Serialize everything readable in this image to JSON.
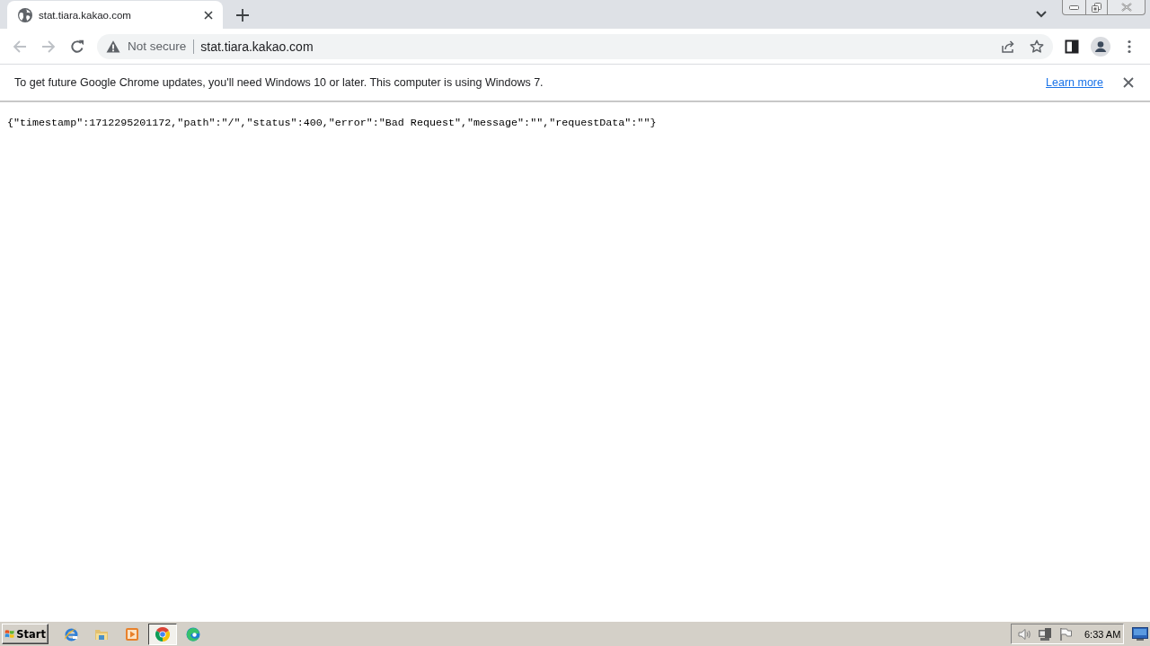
{
  "tabs": [
    {
      "title": "stat.tiara.kakao.com",
      "selected": true
    }
  ],
  "nav_buttons": [
    {
      "kind": "back",
      "disabled": true
    },
    {
      "kind": "forward",
      "disabled": true
    },
    {
      "kind": "reload",
      "disabled": false
    }
  ],
  "address_bar": {
    "security_label": "Not secure",
    "url": "stat.tiara.kakao.com"
  },
  "infobar": {
    "message": "To get future Google Chrome updates, you'll need Windows 10 or later. This computer is using Windows 7.",
    "link": "Learn more"
  },
  "page": {
    "text": "{\"timestamp\":1712295201172,\"path\":\"/\",\"status\":400,\"error\":\"Bad Request\",\"message\":\"\",\"requestData\":\"\"}"
  },
  "taskbar": {
    "start_label": "Start",
    "apps": [
      {
        "kind": "ie",
        "selected": false
      },
      {
        "kind": "folder",
        "selected": false
      },
      {
        "kind": "player",
        "selected": false
      },
      {
        "kind": "chrome",
        "selected": true
      },
      {
        "kind": "edge",
        "selected": false
      }
    ],
    "clock": "6:33 AM"
  }
}
